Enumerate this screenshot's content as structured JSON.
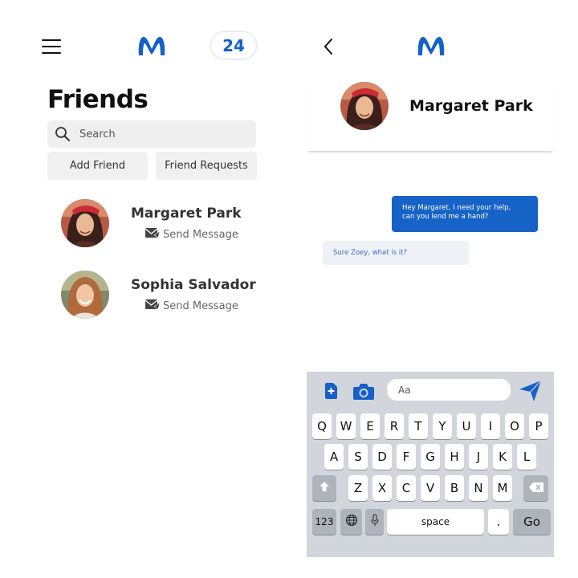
{
  "left_screen": {
    "notification_count": "24",
    "title": "Friends",
    "search": {
      "placeholder": "Search"
    },
    "buttons": {
      "add_friend": "Add Friend",
      "friend_requests": "Friend Requests"
    },
    "friends": [
      {
        "name": "Margaret Park",
        "action": "Send Message"
      },
      {
        "name": "Sophia Salvador",
        "action": "Send Message"
      }
    ]
  },
  "right_screen": {
    "contact_name": "Margaret Park",
    "messages": [
      {
        "direction": "outgoing",
        "lines": [
          "Hey Margaret, I need your help,",
          "can you lend me a hand?"
        ]
      },
      {
        "direction": "incoming",
        "text": "Sure Zoey, what is it?"
      }
    ],
    "composer": {
      "placeholder": "Aa"
    },
    "keyboard": {
      "row1": [
        "Q",
        "W",
        "E",
        "R",
        "T",
        "Y",
        "U",
        "I",
        "O",
        "P"
      ],
      "row2": [
        "A",
        "S",
        "D",
        "F",
        "G",
        "H",
        "J",
        "K",
        "L"
      ],
      "row3": [
        "Z",
        "X",
        "C",
        "V",
        "B",
        "N",
        "M"
      ],
      "numbers_key": "123",
      "space_key": "space",
      "period_key": ".",
      "go_key": "Go"
    }
  },
  "colors": {
    "brand_blue": "#1560c9",
    "keyboard_bg": "#d2d5db",
    "bubble_out": "#1663c7",
    "bubble_in": "#eef1f6"
  },
  "icons": [
    "menu-icon",
    "app-logo-icon",
    "search-icon",
    "message-icon",
    "back-icon",
    "add-file-icon",
    "camera-icon",
    "send-icon",
    "shift-icon",
    "backspace-icon",
    "globe-icon",
    "microphone-icon"
  ]
}
